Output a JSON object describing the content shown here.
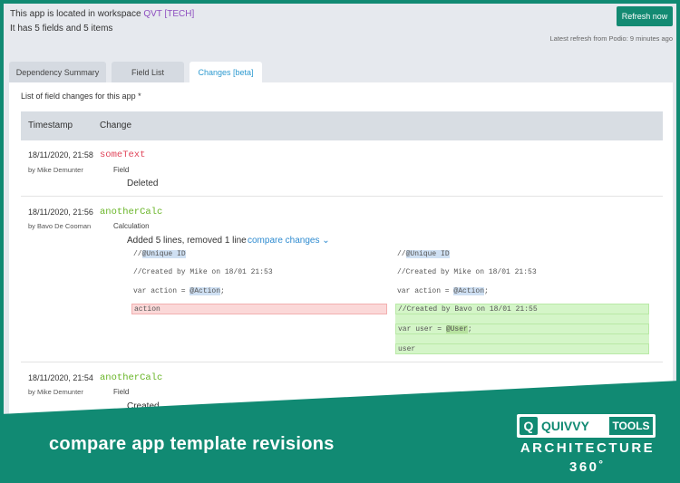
{
  "header": {
    "info_prefix": "This app is located in workspace",
    "workspace": "QVT [TECH]",
    "info_fields": "It has 5 fields and 5 items",
    "refresh_label": "Refresh now",
    "latest_refresh": "Latest refresh from Podio: 9 minutes ago"
  },
  "tabs": [
    {
      "label": "Dependency Summary"
    },
    {
      "label": "Field List"
    },
    {
      "label": "Changes [beta]"
    }
  ],
  "panel": {
    "title": "List of field changes for this app *",
    "columns": [
      "Timestamp",
      "Change"
    ]
  },
  "changes": [
    {
      "timestamp": "18/11/2020, 21:58",
      "by": "by Mike Demunter",
      "field": "someText",
      "field_type": "Field",
      "action": "Deleted",
      "color": "#e0455a"
    },
    {
      "timestamp": "18/11/2020, 21:56",
      "by": "by Bavo De Cooman",
      "field": "anotherCalc",
      "field_type": "Calculation",
      "action": "Added 5 lines, removed 1 line",
      "compare_label": "compare changes",
      "color": "#69b527",
      "left_code": {
        "l1_pre": "//",
        "l1_hl": "@Unique ID",
        "l2": "//Created by Mike on 18/01 21:53",
        "l3_pre": "var action = ",
        "l3_hl": "@Action",
        "l3_post": ";",
        "removed": "action"
      },
      "right_code": {
        "l1_pre": "//",
        "l1_hl": "@Unique ID",
        "l2": "//Created by Mike on 18/01 21:53",
        "l3_pre": "var action = ",
        "l3_hl": "@Action",
        "l3_post": ";",
        "added1": "//Created by Bavo on 18/01 21:55",
        "added2_pre": "var user = ",
        "added2_hl": "@User",
        "added2_post": ";",
        "added3": "user"
      }
    },
    {
      "timestamp": "18/11/2020, 21:54",
      "by": "by Mike Demunter",
      "field": "anotherCalc",
      "field_type": "Field",
      "action": "Created",
      "color": "#69b527"
    }
  ],
  "banner": {
    "caption": "compare app template revisions",
    "logo_name": "QUIVVY",
    "logo_tools": "TOOLS",
    "arch": "ARCHITECTURE",
    "deg": "360˚",
    "background": "#118a73"
  }
}
